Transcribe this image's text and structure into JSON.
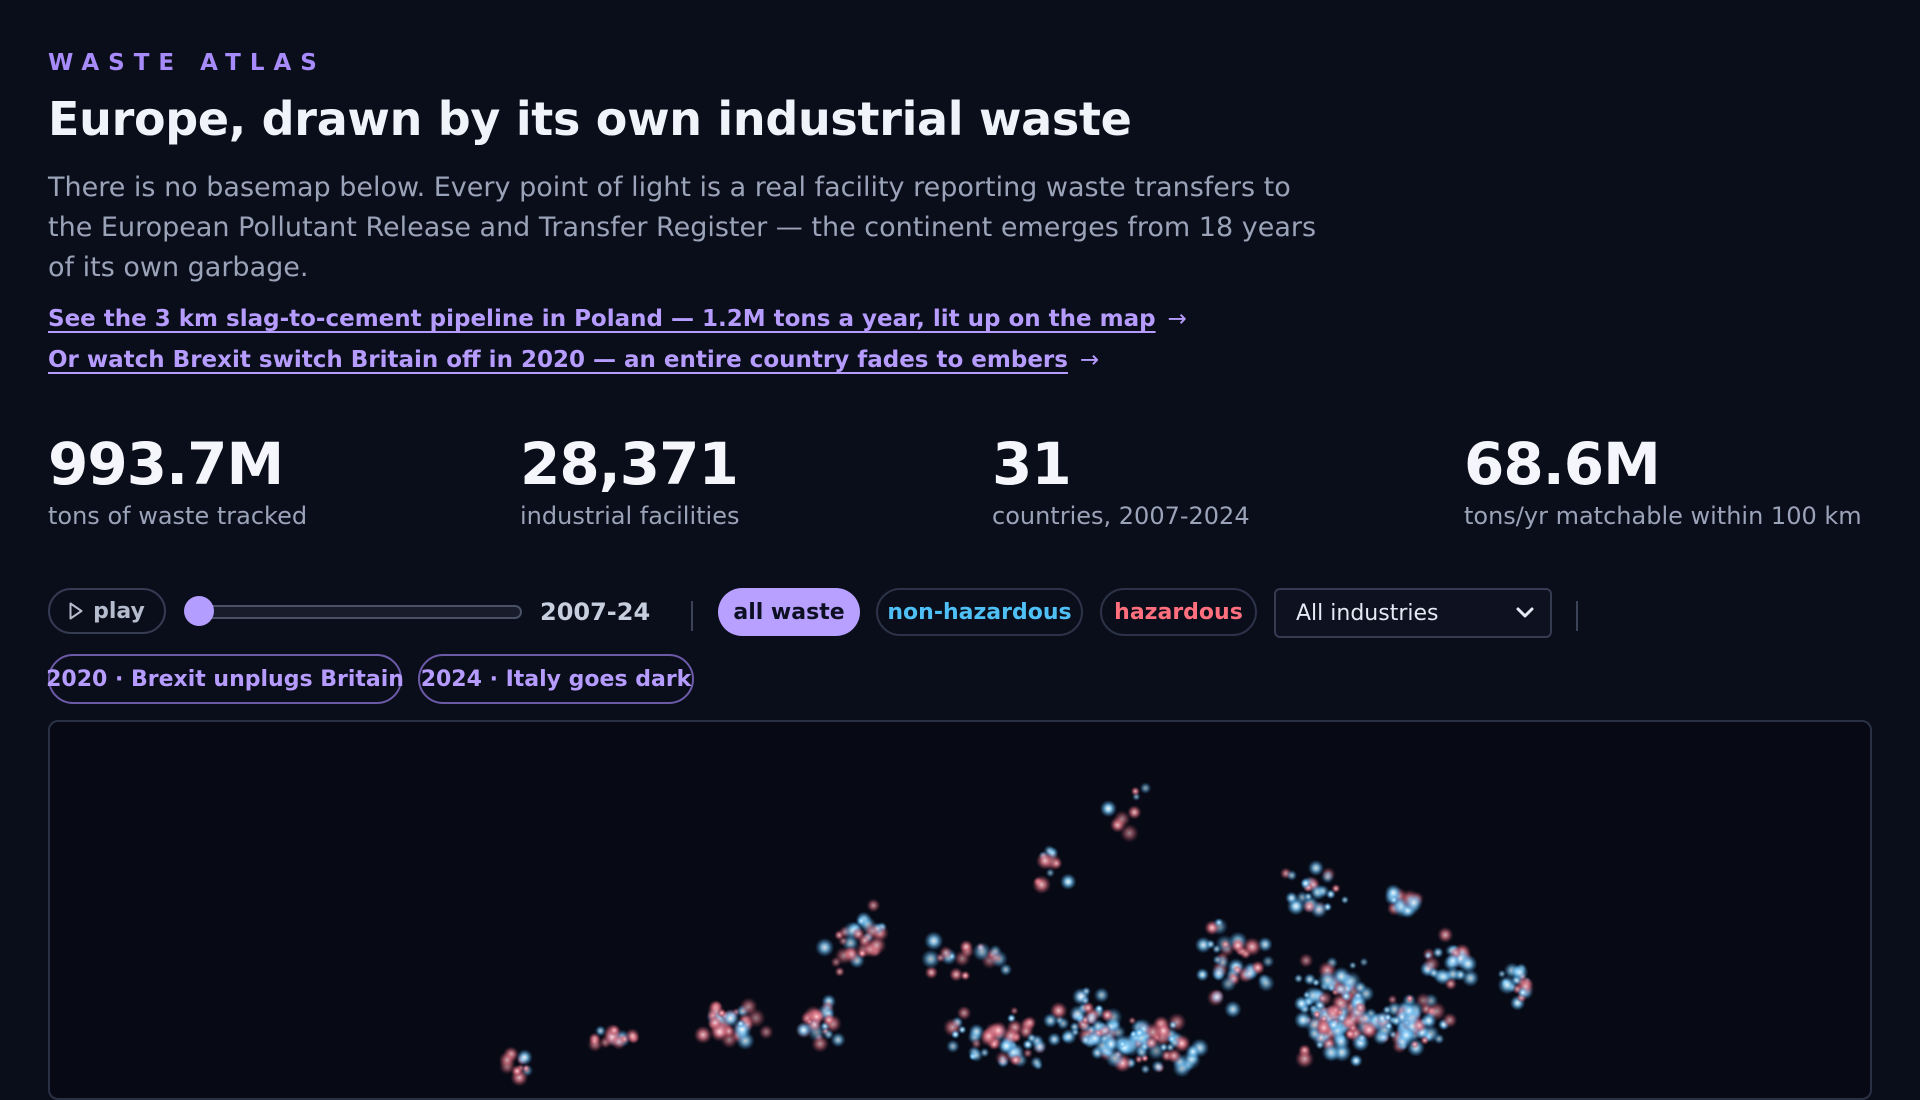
{
  "header": {
    "kicker": "WASTE ATLAS",
    "title": "Europe, drawn by its own industrial waste",
    "lede": "There is no basemap below. Every point of light is a real facility reporting waste transfers to the European Pollutant Release and Transfer Register — the continent emerges from 18 years of its own garbage."
  },
  "links": [
    {
      "label": "See the 3 km slag-to-cement pipeline in Poland — 1.2M tons a year, lit up on the map",
      "arrow": "→"
    },
    {
      "label": "Or watch Brexit switch Britain off in 2020 — an entire country fades to embers",
      "arrow": "→"
    }
  ],
  "stats": [
    {
      "value": "993.7M",
      "label": "tons of waste tracked"
    },
    {
      "value": "28,371",
      "label": "industrial facilities"
    },
    {
      "value": "31",
      "label": "countries, 2007-2024"
    },
    {
      "value": "68.6M",
      "label": "tons/yr matchable within 100 km"
    }
  ],
  "controls": {
    "play_label": "play",
    "year_readout": "2007-24",
    "slider_position": 0,
    "filters": {
      "all": "all waste",
      "non_hazardous": "non-hazardous",
      "hazardous": "hazardous",
      "active": "all"
    },
    "industry_select": {
      "selected": "All industries"
    }
  },
  "events": [
    {
      "label": "2020 · Brexit unplugs Britain"
    },
    {
      "label": "2024 · Italy goes dark"
    }
  ],
  "colors": {
    "background": "#0a0d1a",
    "accent": "#b7a0ff",
    "non_hazardous": "#4fc0f5",
    "hazardous": "#ff6f7d"
  },
  "icons": {
    "play": "play-icon",
    "link_arrow": "arrow-right-icon",
    "select_chevron": "chevron-down-icon"
  }
}
